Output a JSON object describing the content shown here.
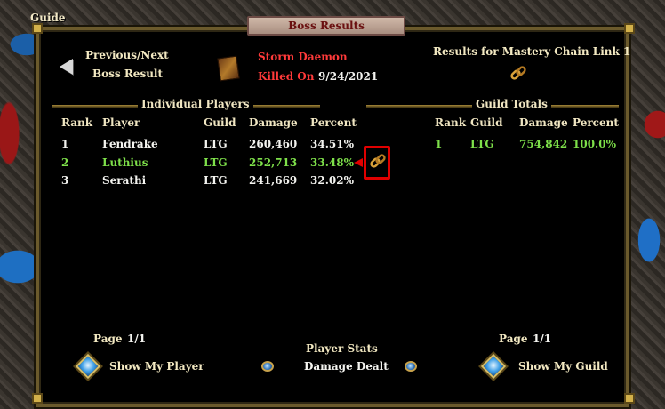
{
  "window": {
    "guide_label": "Guide",
    "title": "Boss Results"
  },
  "nav": {
    "prev_next_line1": "Previous/Next",
    "prev_next_line2": "Boss Result"
  },
  "boss": {
    "name": "Storm Daemon",
    "killed_label": "Killed On",
    "killed_date": "9/24/2021"
  },
  "chain": {
    "results_label": "Results for Mastery Chain Link 1"
  },
  "individual": {
    "section_title": "Individual Players",
    "headers": {
      "rank": "Rank",
      "player": "Player",
      "guild": "Guild",
      "damage": "Damage",
      "percent": "Percent"
    },
    "rows": [
      {
        "rank": "1",
        "player": "Fendrake",
        "guild": "LTG",
        "damage": "260,460",
        "percent": "34.51%",
        "color": "#f4f4f0"
      },
      {
        "rank": "2",
        "player": "Luthius",
        "guild": "LTG",
        "damage": "252,713",
        "percent": "33.48%",
        "color": "#7ee04a"
      },
      {
        "rank": "3",
        "player": "Serathi",
        "guild": "LTG",
        "damage": "241,669",
        "percent": "32.02%",
        "color": "#f4f4f0"
      }
    ],
    "page_label": "Page",
    "page_value": "1/1",
    "show_button": "Show My Player"
  },
  "guild": {
    "section_title": "Guild Totals",
    "headers": {
      "rank": "Rank",
      "guild": "Guild",
      "damage": "Damage",
      "percent": "Percent"
    },
    "rows": [
      {
        "rank": "1",
        "guild": "LTG",
        "damage": "754,842",
        "percent": "100.0%",
        "color": "#7ee04a"
      }
    ],
    "page_label": "Page",
    "page_value": "1/1",
    "show_button": "Show My Guild"
  },
  "stats": {
    "label": "Player Stats",
    "value": "Damage Dealt"
  },
  "icons": {
    "back": "left-arrow-icon",
    "book": "book-icon",
    "chain": "chain-link-icon",
    "gem": "blue-gem-icon",
    "diamond": "blue-diamond-icon"
  },
  "colors": {
    "highlight": "#e00000",
    "boss_name": "#ff3a3a",
    "green": "#7ee04a",
    "header": "#f0e6c2"
  }
}
